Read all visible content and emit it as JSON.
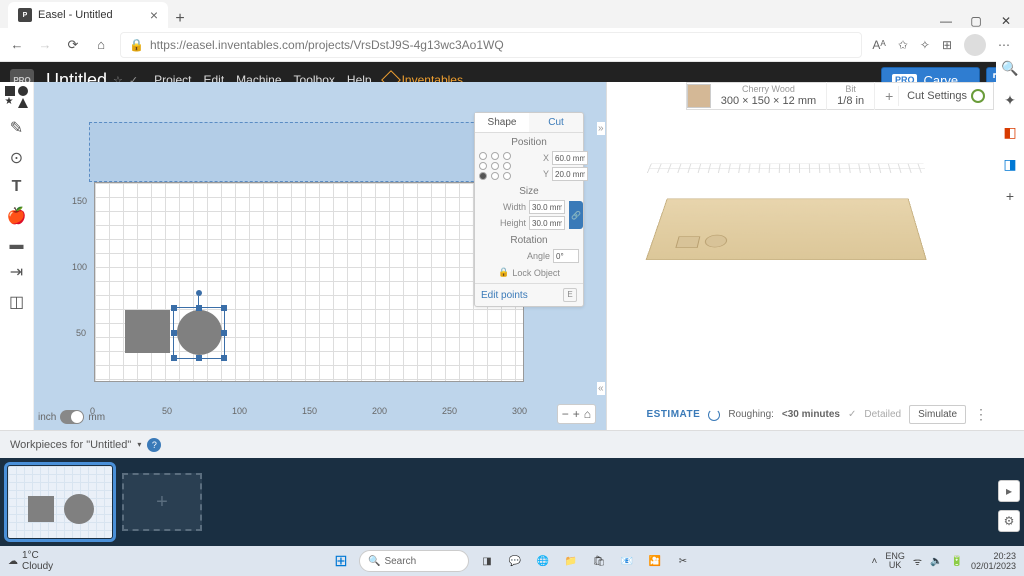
{
  "browser": {
    "tab_title": "Easel - Untitled",
    "url": "https://easel.inventables.com/projects/VrsDstJ9S-4g13wc3Ao1WQ",
    "address_readout_label": "Aᴬ"
  },
  "easel": {
    "project_title": "Untitled",
    "menu": [
      "Project",
      "Edit",
      "Machine",
      "Toolbox",
      "Help"
    ],
    "brand": "Inventables",
    "carve_label": "Carve...",
    "pro_badge": "PRO"
  },
  "settings": {
    "material_name": "Cherry Wood",
    "material_dims": "300 × 150 × 12 mm",
    "bit_label": "Bit",
    "bit_value": "1/8 in",
    "cut_settings": "Cut Settings"
  },
  "canvas": {
    "axis_x": [
      "0",
      "50",
      "100",
      "150",
      "200",
      "250",
      "300"
    ],
    "axis_y": [
      "50",
      "100",
      "150"
    ],
    "unit_left": "inch",
    "unit_right": "mm"
  },
  "inspector": {
    "tabs": {
      "shape": "Shape",
      "cut": "Cut"
    },
    "position_label": "Position",
    "x_label": "X",
    "x_value": "60.0 mm",
    "y_label": "Y",
    "y_value": "20.0 mm",
    "size_label": "Size",
    "width_label": "Width",
    "width_value": "30.0 mm",
    "height_label": "Height",
    "height_value": "30.0 mm",
    "rotation_label": "Rotation",
    "angle_label": "Angle",
    "angle_value": "0°",
    "lock_label": "Lock Object",
    "edit_points": "Edit points",
    "e_key": "E"
  },
  "estimate": {
    "label": "ESTIMATE",
    "roughing": "Roughing:",
    "roughing_val": "<30 minutes",
    "detailed": "Detailed",
    "simulate": "Simulate"
  },
  "workpieces": {
    "header": "Workpieces for \"Untitled\""
  },
  "taskbar": {
    "temp": "1°C",
    "weather": "Cloudy",
    "search": "Search",
    "lang": "ENG",
    "region": "UK",
    "time": "20:23",
    "date": "02/01/2023"
  }
}
